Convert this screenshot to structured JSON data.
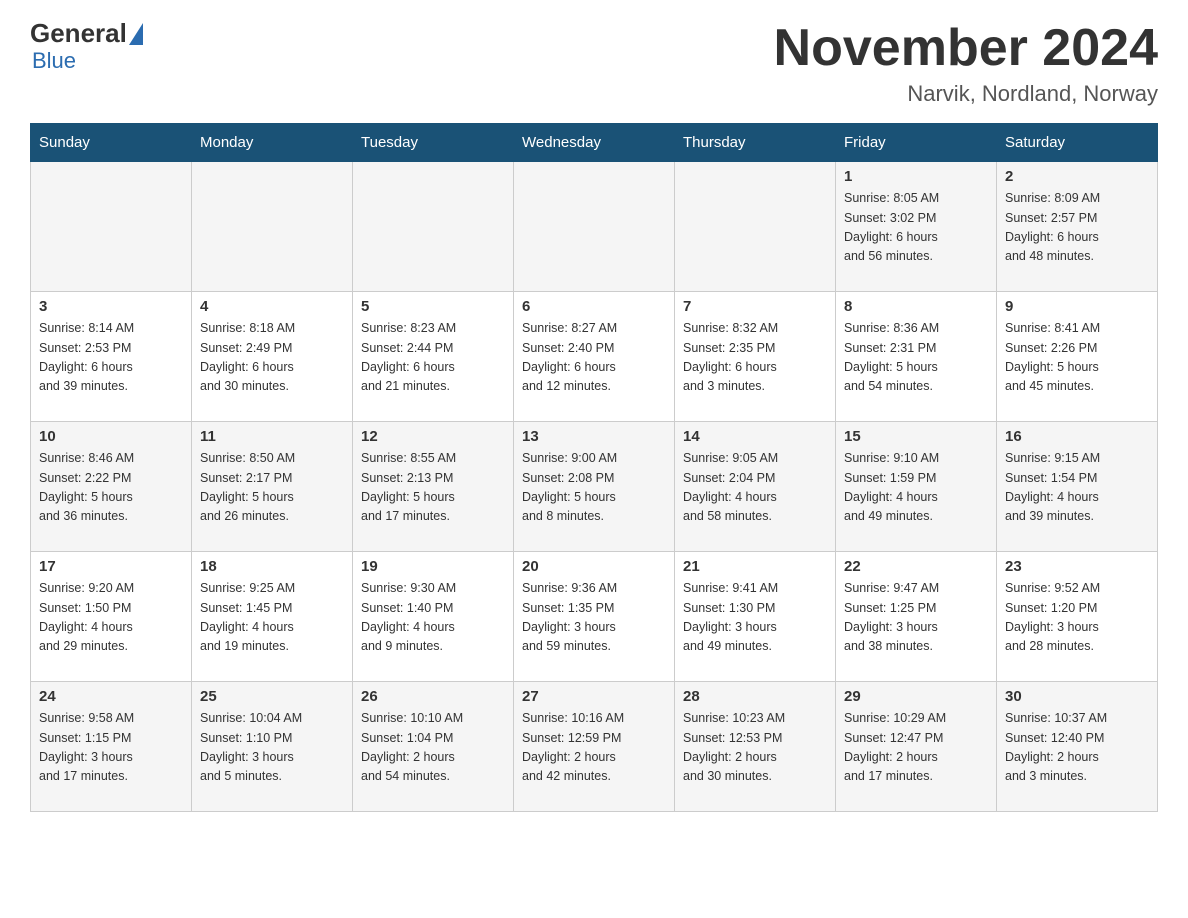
{
  "logo": {
    "general": "General",
    "blue": "Blue"
  },
  "title": "November 2024",
  "location": "Narvik, Nordland, Norway",
  "headers": [
    "Sunday",
    "Monday",
    "Tuesday",
    "Wednesday",
    "Thursday",
    "Friday",
    "Saturday"
  ],
  "weeks": [
    [
      {
        "day": "",
        "info": ""
      },
      {
        "day": "",
        "info": ""
      },
      {
        "day": "",
        "info": ""
      },
      {
        "day": "",
        "info": ""
      },
      {
        "day": "",
        "info": ""
      },
      {
        "day": "1",
        "info": "Sunrise: 8:05 AM\nSunset: 3:02 PM\nDaylight: 6 hours\nand 56 minutes."
      },
      {
        "day": "2",
        "info": "Sunrise: 8:09 AM\nSunset: 2:57 PM\nDaylight: 6 hours\nand 48 minutes."
      }
    ],
    [
      {
        "day": "3",
        "info": "Sunrise: 8:14 AM\nSunset: 2:53 PM\nDaylight: 6 hours\nand 39 minutes."
      },
      {
        "day": "4",
        "info": "Sunrise: 8:18 AM\nSunset: 2:49 PM\nDaylight: 6 hours\nand 30 minutes."
      },
      {
        "day": "5",
        "info": "Sunrise: 8:23 AM\nSunset: 2:44 PM\nDaylight: 6 hours\nand 21 minutes."
      },
      {
        "day": "6",
        "info": "Sunrise: 8:27 AM\nSunset: 2:40 PM\nDaylight: 6 hours\nand 12 minutes."
      },
      {
        "day": "7",
        "info": "Sunrise: 8:32 AM\nSunset: 2:35 PM\nDaylight: 6 hours\nand 3 minutes."
      },
      {
        "day": "8",
        "info": "Sunrise: 8:36 AM\nSunset: 2:31 PM\nDaylight: 5 hours\nand 54 minutes."
      },
      {
        "day": "9",
        "info": "Sunrise: 8:41 AM\nSunset: 2:26 PM\nDaylight: 5 hours\nand 45 minutes."
      }
    ],
    [
      {
        "day": "10",
        "info": "Sunrise: 8:46 AM\nSunset: 2:22 PM\nDaylight: 5 hours\nand 36 minutes."
      },
      {
        "day": "11",
        "info": "Sunrise: 8:50 AM\nSunset: 2:17 PM\nDaylight: 5 hours\nand 26 minutes."
      },
      {
        "day": "12",
        "info": "Sunrise: 8:55 AM\nSunset: 2:13 PM\nDaylight: 5 hours\nand 17 minutes."
      },
      {
        "day": "13",
        "info": "Sunrise: 9:00 AM\nSunset: 2:08 PM\nDaylight: 5 hours\nand 8 minutes."
      },
      {
        "day": "14",
        "info": "Sunrise: 9:05 AM\nSunset: 2:04 PM\nDaylight: 4 hours\nand 58 minutes."
      },
      {
        "day": "15",
        "info": "Sunrise: 9:10 AM\nSunset: 1:59 PM\nDaylight: 4 hours\nand 49 minutes."
      },
      {
        "day": "16",
        "info": "Sunrise: 9:15 AM\nSunset: 1:54 PM\nDaylight: 4 hours\nand 39 minutes."
      }
    ],
    [
      {
        "day": "17",
        "info": "Sunrise: 9:20 AM\nSunset: 1:50 PM\nDaylight: 4 hours\nand 29 minutes."
      },
      {
        "day": "18",
        "info": "Sunrise: 9:25 AM\nSunset: 1:45 PM\nDaylight: 4 hours\nand 19 minutes."
      },
      {
        "day": "19",
        "info": "Sunrise: 9:30 AM\nSunset: 1:40 PM\nDaylight: 4 hours\nand 9 minutes."
      },
      {
        "day": "20",
        "info": "Sunrise: 9:36 AM\nSunset: 1:35 PM\nDaylight: 3 hours\nand 59 minutes."
      },
      {
        "day": "21",
        "info": "Sunrise: 9:41 AM\nSunset: 1:30 PM\nDaylight: 3 hours\nand 49 minutes."
      },
      {
        "day": "22",
        "info": "Sunrise: 9:47 AM\nSunset: 1:25 PM\nDaylight: 3 hours\nand 38 minutes."
      },
      {
        "day": "23",
        "info": "Sunrise: 9:52 AM\nSunset: 1:20 PM\nDaylight: 3 hours\nand 28 minutes."
      }
    ],
    [
      {
        "day": "24",
        "info": "Sunrise: 9:58 AM\nSunset: 1:15 PM\nDaylight: 3 hours\nand 17 minutes."
      },
      {
        "day": "25",
        "info": "Sunrise: 10:04 AM\nSunset: 1:10 PM\nDaylight: 3 hours\nand 5 minutes."
      },
      {
        "day": "26",
        "info": "Sunrise: 10:10 AM\nSunset: 1:04 PM\nDaylight: 2 hours\nand 54 minutes."
      },
      {
        "day": "27",
        "info": "Sunrise: 10:16 AM\nSunset: 12:59 PM\nDaylight: 2 hours\nand 42 minutes."
      },
      {
        "day": "28",
        "info": "Sunrise: 10:23 AM\nSunset: 12:53 PM\nDaylight: 2 hours\nand 30 minutes."
      },
      {
        "day": "29",
        "info": "Sunrise: 10:29 AM\nSunset: 12:47 PM\nDaylight: 2 hours\nand 17 minutes."
      },
      {
        "day": "30",
        "info": "Sunrise: 10:37 AM\nSunset: 12:40 PM\nDaylight: 2 hours\nand 3 minutes."
      }
    ]
  ]
}
